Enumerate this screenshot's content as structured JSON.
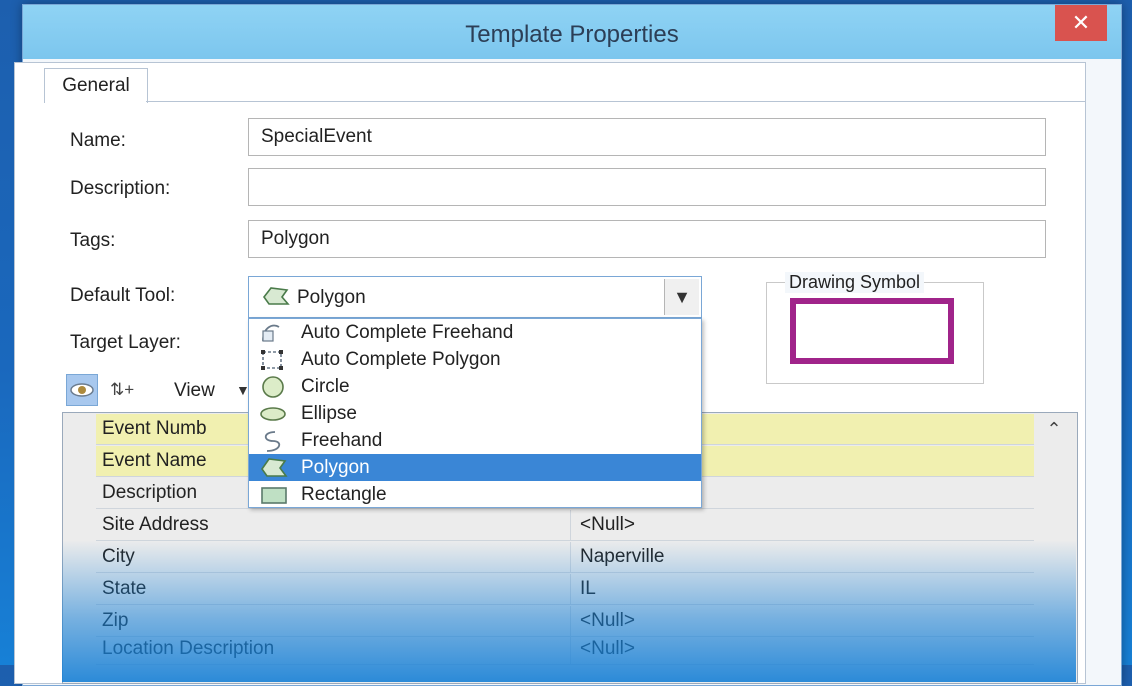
{
  "window": {
    "title": "Template Properties",
    "close_icon": "close-icon",
    "tab": "General"
  },
  "form": {
    "name_label": "Name:",
    "name_value": "SpecialEvent",
    "description_label": "Description:",
    "description_value": "",
    "tags_label": "Tags:",
    "tags_value": "Polygon",
    "default_tool_label": "Default Tool:",
    "default_tool_value": "Polygon",
    "target_layer_label": "Target Layer:",
    "drawing_symbol_label": "Drawing Symbol",
    "symbol_color": "#a0248a"
  },
  "toolbar": {
    "view_label": "View"
  },
  "dropdown": {
    "items": [
      {
        "label": "Auto Complete Freehand",
        "icon": "auto-complete-freehand-icon"
      },
      {
        "label": "Auto Complete Polygon",
        "icon": "auto-complete-polygon-icon"
      },
      {
        "label": "Circle",
        "icon": "circle-icon"
      },
      {
        "label": "Ellipse",
        "icon": "ellipse-icon"
      },
      {
        "label": "Freehand",
        "icon": "freehand-icon"
      },
      {
        "label": "Polygon",
        "icon": "polygon-icon",
        "selected": true
      },
      {
        "label": "Rectangle",
        "icon": "rectangle-icon"
      }
    ]
  },
  "grid": {
    "rows": [
      {
        "key": "Event Numb",
        "value": ""
      },
      {
        "key": "Event Name",
        "value": ""
      },
      {
        "key": "Description",
        "value": ""
      },
      {
        "key": "Site Address",
        "value": "<Null>"
      },
      {
        "key": "City",
        "value": "Naperville"
      },
      {
        "key": "State",
        "value": "IL"
      },
      {
        "key": "Zip",
        "value": "<Null>"
      },
      {
        "key": "Location Description",
        "value": "<Null>"
      }
    ]
  }
}
